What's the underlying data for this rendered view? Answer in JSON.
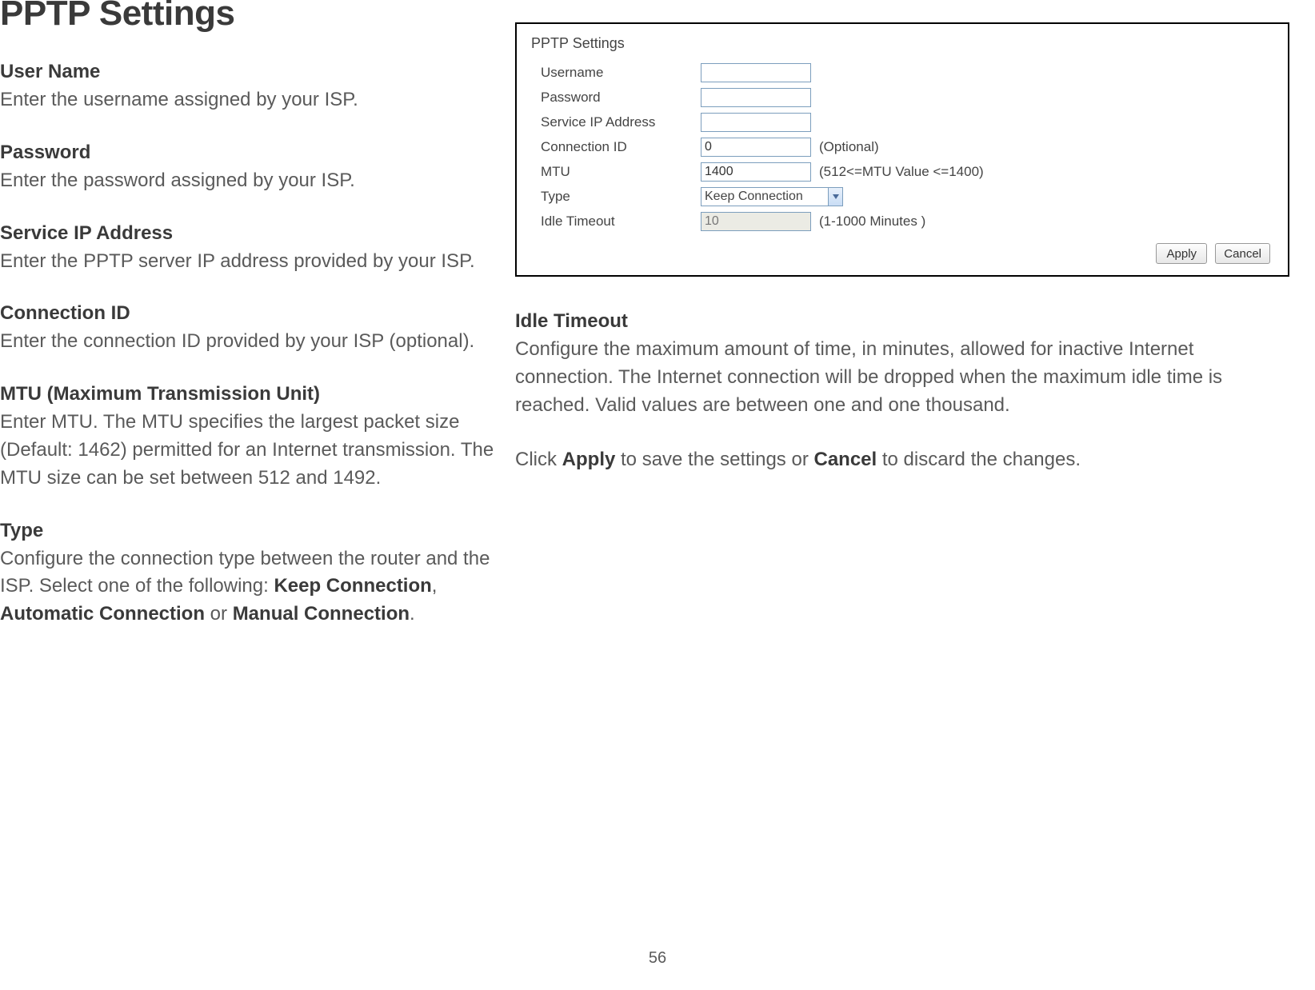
{
  "left": {
    "title": "PPTP Settings",
    "fields": [
      {
        "label": "User Name",
        "desc": "Enter the username assigned by your ISP."
      },
      {
        "label": "Password",
        "desc": "Enter the password assigned by your ISP."
      },
      {
        "label": "Service IP Address",
        "desc": "Enter the PPTP server IP address provided by your ISP."
      },
      {
        "label": "Connection ID",
        "desc": "Enter the connection ID provided by your ISP (optional)."
      },
      {
        "label": "MTU (Maximum Transmission Unit)",
        "desc": "Enter MTU. The MTU specifies the largest packet size (Default: 1462) permitted for an Internet transmission. The MTU size can be set between 512 and 1492."
      }
    ],
    "type_label": "Type",
    "type_desc_pre": "Configure the connection type between the router and the ISP. Select one of the following: ",
    "type_opt1": "Keep Connection",
    "type_sep1": ", ",
    "type_opt2": "Automatic Connection",
    "type_sep2": " or ",
    "type_opt3": "Manual Connection",
    "type_end": "."
  },
  "panel": {
    "title": "PPTP Settings",
    "rows": {
      "username_label": "Username",
      "username_value": "",
      "password_label": "Password",
      "password_value": "",
      "service_ip_label": "Service IP Address",
      "service_ip_value": "",
      "connection_id_label": "Connection ID",
      "connection_id_value": "0",
      "connection_id_hint": "(Optional)",
      "mtu_label": "MTU",
      "mtu_value": "1400",
      "mtu_hint": "(512<=MTU Value <=1400)",
      "type_label": "Type",
      "type_value": "Keep Connection",
      "idle_label": "Idle Timeout",
      "idle_value": "10",
      "idle_hint": "(1-1000 Minutes )"
    },
    "buttons": {
      "apply": "Apply",
      "cancel": "Cancel"
    }
  },
  "right": {
    "idle_label": "Idle Timeout",
    "idle_desc": "Configure the maximum amount of time, in minutes, allowed for inactive Internet connection. The Internet connection will be dropped when the maximum idle time is reached. Valid values are between one and one thousand.",
    "apply_pre": "Click ",
    "apply_b1": "Apply",
    "apply_mid": " to save the settings or ",
    "apply_b2": "Cancel",
    "apply_post": " to discard the changes."
  },
  "page_number": "56"
}
